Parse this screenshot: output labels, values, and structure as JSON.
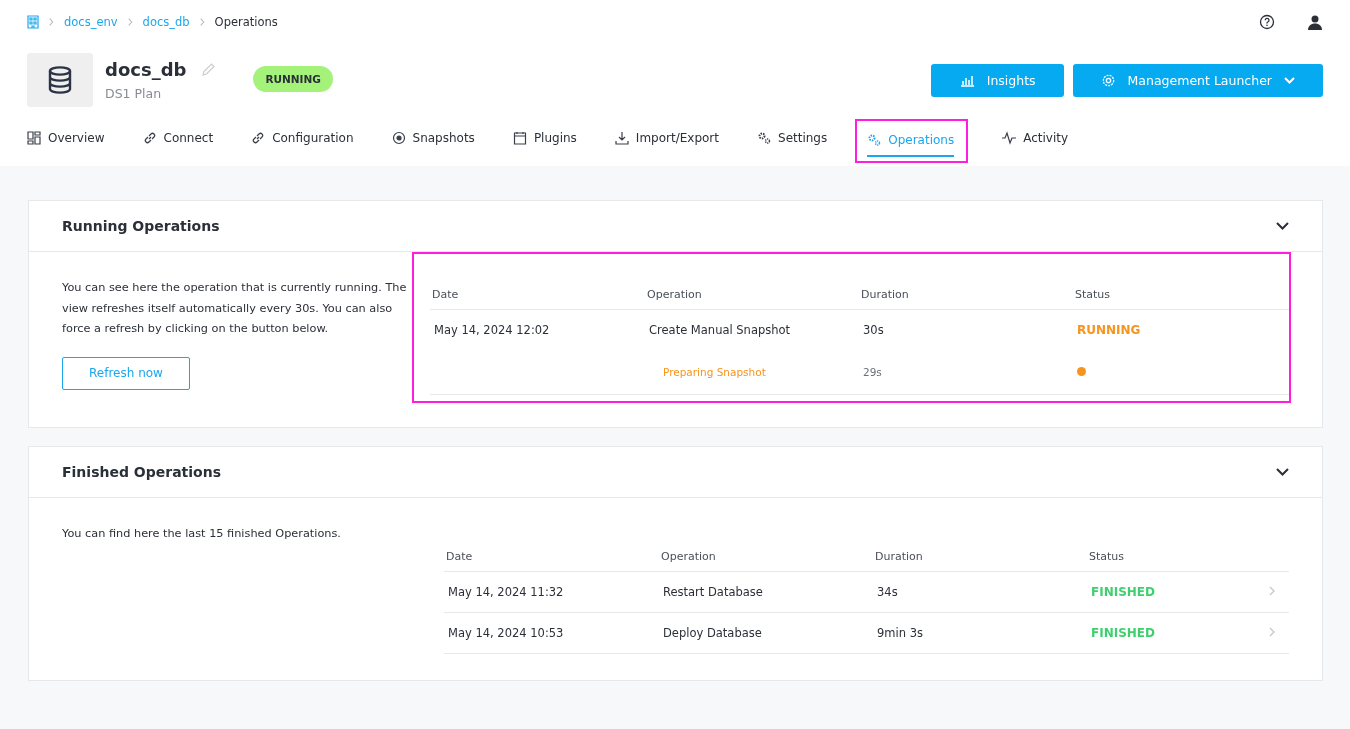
{
  "breadcrumb": [
    {
      "label": "docs_env",
      "link": true
    },
    {
      "label": "docs_db",
      "link": true
    },
    {
      "label": "Operations",
      "link": false
    }
  ],
  "database": {
    "name": "docs_db",
    "plan": "DS1 Plan",
    "status": "RUNNING"
  },
  "buttons": [
    {
      "label": "Insights",
      "dropdown": false
    },
    {
      "label": "Management Launcher",
      "dropdown": true
    }
  ],
  "tabs": [
    {
      "label": "Overview",
      "selected": false,
      "highlighted": false
    },
    {
      "label": "Connect",
      "selected": false,
      "highlighted": false
    },
    {
      "label": "Configuration",
      "selected": false,
      "highlighted": false
    },
    {
      "label": "Snapshots",
      "selected": false,
      "highlighted": false
    },
    {
      "label": "Plugins",
      "selected": false,
      "highlighted": false
    },
    {
      "label": "Import/Export",
      "selected": false,
      "highlighted": false
    },
    {
      "label": "Settings",
      "selected": false,
      "highlighted": false
    },
    {
      "label": "Operations",
      "selected": true,
      "highlighted": true
    },
    {
      "label": "Activity",
      "selected": false,
      "highlighted": false
    }
  ],
  "running_operations": {
    "title": "Running Operations",
    "expanded": true,
    "description": "You can see here the operation that is currently running. The view refreshes itself automatically every 30s. You can also force a refresh by clicking on the button below.",
    "refresh_button": "Refresh now",
    "highlighted": true,
    "columns": [
      "Date",
      "Operation",
      "Duration",
      "Status"
    ],
    "rows": [
      {
        "date": "May 14, 2024 12:02",
        "operation": "Create Manual Snapshot",
        "duration": "30s",
        "status": "RUNNING",
        "kind": "running",
        "steps": [
          {
            "label": "Preparing Snapshot",
            "duration": "29s",
            "color": "#f7941d"
          }
        ]
      }
    ]
  },
  "finished_operations": {
    "title": "Finished Operations",
    "expanded": true,
    "description": "You can find here the last 15 finished Operations.",
    "columns": [
      "Date",
      "Operation",
      "Duration",
      "Status"
    ],
    "rows": [
      {
        "date": "May 14, 2024 11:32",
        "operation": "Restart Database",
        "duration": "34s",
        "status": "FINISHED",
        "kind": "finished"
      },
      {
        "date": "May 14, 2024 10:53",
        "operation": "Deploy Database",
        "duration": "9min 3s",
        "status": "FINISHED",
        "kind": "finished"
      }
    ]
  }
}
